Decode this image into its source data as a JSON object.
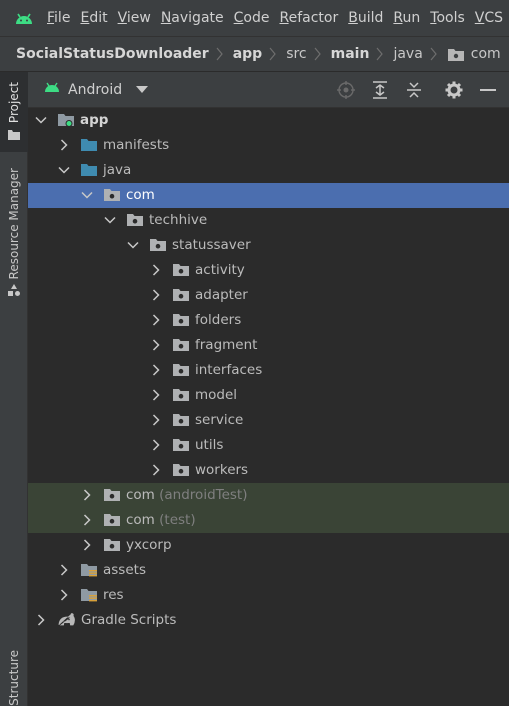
{
  "menu": [
    "File",
    "Edit",
    "View",
    "Navigate",
    "Code",
    "Refactor",
    "Build",
    "Run",
    "Tools",
    "VCS"
  ],
  "breadcrumb": {
    "project": "SocialStatusDownloader",
    "module": "app",
    "src": "src",
    "main": "main",
    "java": "java",
    "pkg": "com"
  },
  "side_tabs": {
    "project": "Project",
    "resource_manager": "Resource Manager",
    "structure": "Structure"
  },
  "panel": {
    "view_mode": "Android"
  },
  "tree": [
    {
      "label": "app",
      "suffix": "",
      "depth": 0,
      "icon": "module",
      "arrow": "down",
      "bold": true,
      "state": ""
    },
    {
      "label": "manifests",
      "suffix": "",
      "depth": 1,
      "icon": "folder-blue",
      "arrow": "right",
      "bold": false,
      "state": ""
    },
    {
      "label": "java",
      "suffix": "",
      "depth": 1,
      "icon": "folder-blue",
      "arrow": "down",
      "bold": false,
      "state": ""
    },
    {
      "label": "com",
      "suffix": "",
      "depth": 2,
      "icon": "package",
      "arrow": "down",
      "bold": false,
      "state": "selected"
    },
    {
      "label": "techhive",
      "suffix": "",
      "depth": 3,
      "icon": "package",
      "arrow": "down",
      "bold": false,
      "state": ""
    },
    {
      "label": "statussaver",
      "suffix": "",
      "depth": 4,
      "icon": "package",
      "arrow": "down",
      "bold": false,
      "state": ""
    },
    {
      "label": "activity",
      "suffix": "",
      "depth": 5,
      "icon": "package",
      "arrow": "right",
      "bold": false,
      "state": ""
    },
    {
      "label": "adapter",
      "suffix": "",
      "depth": 5,
      "icon": "package",
      "arrow": "right",
      "bold": false,
      "state": ""
    },
    {
      "label": "folders",
      "suffix": "",
      "depth": 5,
      "icon": "package",
      "arrow": "right",
      "bold": false,
      "state": ""
    },
    {
      "label": "fragment",
      "suffix": "",
      "depth": 5,
      "icon": "package",
      "arrow": "right",
      "bold": false,
      "state": ""
    },
    {
      "label": "interfaces",
      "suffix": "",
      "depth": 5,
      "icon": "package",
      "arrow": "right",
      "bold": false,
      "state": ""
    },
    {
      "label": "model",
      "suffix": "",
      "depth": 5,
      "icon": "package",
      "arrow": "right",
      "bold": false,
      "state": ""
    },
    {
      "label": "service",
      "suffix": "",
      "depth": 5,
      "icon": "package",
      "arrow": "right",
      "bold": false,
      "state": ""
    },
    {
      "label": "utils",
      "suffix": "",
      "depth": 5,
      "icon": "package",
      "arrow": "right",
      "bold": false,
      "state": ""
    },
    {
      "label": "workers",
      "suffix": "",
      "depth": 5,
      "icon": "package",
      "arrow": "right",
      "bold": false,
      "state": ""
    },
    {
      "label": "com",
      "suffix": " (androidTest)",
      "depth": 2,
      "icon": "package",
      "arrow": "right",
      "bold": false,
      "state": "test"
    },
    {
      "label": "com",
      "suffix": " (test)",
      "depth": 2,
      "icon": "package",
      "arrow": "right",
      "bold": false,
      "state": "test"
    },
    {
      "label": "yxcorp",
      "suffix": "",
      "depth": 2,
      "icon": "package",
      "arrow": "right",
      "bold": false,
      "state": ""
    },
    {
      "label": "assets",
      "suffix": "",
      "depth": 1,
      "icon": "folder-res",
      "arrow": "right",
      "bold": false,
      "state": ""
    },
    {
      "label": "res",
      "suffix": "",
      "depth": 1,
      "icon": "folder-res",
      "arrow": "right",
      "bold": false,
      "state": ""
    },
    {
      "label": "Gradle Scripts",
      "suffix": "",
      "depth": 0,
      "icon": "gradle",
      "arrow": "right",
      "bold": false,
      "state": ""
    }
  ],
  "colors": {
    "selection": "#4b6eaf",
    "test_background": "#3a4436",
    "android_green": "#3ddc84",
    "folder_blue": "#3f8bb0"
  }
}
